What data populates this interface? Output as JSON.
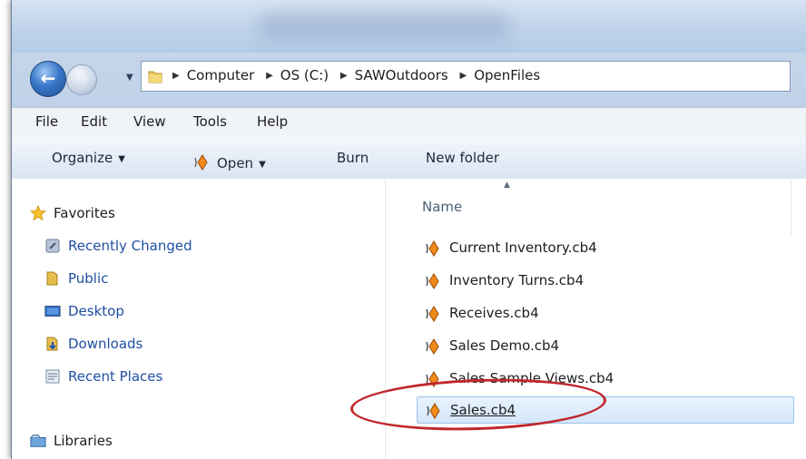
{
  "window": {
    "nav": {
      "back_icon": "back-arrow-icon",
      "forward_icon": "forward-arrow-icon",
      "history_icon": "chevron-down-icon"
    },
    "address": {
      "folder_icon": "folder-icon",
      "crumbs": [
        "Computer",
        "OS (C:)",
        "SAWOutdoors",
        "OpenFiles"
      ]
    }
  },
  "menubar": {
    "items": [
      "File",
      "Edit",
      "View",
      "Tools",
      "Help"
    ]
  },
  "toolbar": {
    "organize": "Organize",
    "open": "Open",
    "burn": "Burn",
    "new_folder": "New folder"
  },
  "navpane": {
    "favorites": "Favorites",
    "items": [
      {
        "label": "Recently Changed",
        "icon": "recent-changed-icon"
      },
      {
        "label": "Public",
        "icon": "folder-icon"
      },
      {
        "label": "Desktop",
        "icon": "desktop-icon"
      },
      {
        "label": "Downloads",
        "icon": "downloads-icon"
      },
      {
        "label": "Recent Places",
        "icon": "recent-places-icon"
      }
    ],
    "libraries": "Libraries"
  },
  "filepane": {
    "column_name": "Name",
    "files": [
      "Current Inventory.cb4",
      "Inventory Turns.cb4",
      "Receives.cb4",
      "Sales Demo.cb4",
      "Sales Sample Views.cb4",
      "Sales.cb4"
    ],
    "selected": "Sales.cb4"
  },
  "colors": {
    "link": "#1f4fa3",
    "highlight": "#c0272d",
    "selection": "#d4e7fb"
  }
}
